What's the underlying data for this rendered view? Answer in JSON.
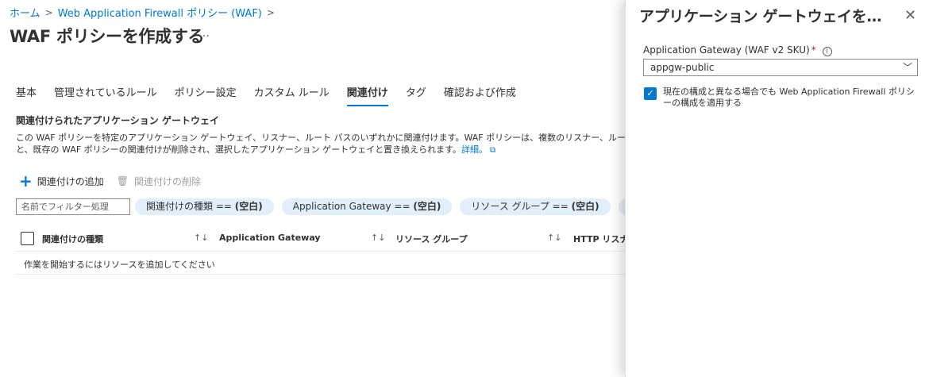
{
  "breadcrumb": {
    "items": [
      "ホーム",
      "Web Application Firewall ポリシー (WAF)"
    ],
    "separator": ">"
  },
  "page": {
    "title": "WAF ポリシーを作成する",
    "more": "…"
  },
  "tabs": [
    {
      "label": "基本",
      "active": false
    },
    {
      "label": "管理されているルール",
      "active": false
    },
    {
      "label": "ポリシー設定",
      "active": false
    },
    {
      "label": "カスタム ルール",
      "active": false
    },
    {
      "label": "関連付け",
      "active": true
    },
    {
      "label": "タグ",
      "active": false
    },
    {
      "label": "確認および作成",
      "active": false
    }
  ],
  "section": {
    "title": "関連付けられたアプリケーション ゲートウェイ",
    "description_line1": "この WAF ポリシーを特定のアプリケーション ゲートウェイ、リスナー、ルート パスのいずれかに関連付けます。WAF ポリシーは、複数のリスナー、ルート パス、アプリケーション",
    "description_line2": "と、既存の WAF ポリシーの関連付けが削除され、選択したアプリケーション ゲートウェイと置き換えられます。",
    "learn_more": "詳細。"
  },
  "toolbar": {
    "add_label": "関連付けの追加",
    "delete_label": "関連付けの削除"
  },
  "filter": {
    "placeholder": "名前でフィルター処理",
    "pills": [
      {
        "key": "関連付けの種類 == ",
        "value": "(空白)"
      },
      {
        "key": "Application Gateway == ",
        "value": "(空白)"
      },
      {
        "key": "リソース グループ == ",
        "value": "(空白)"
      },
      {
        "key": "HTTP",
        "value": ""
      }
    ]
  },
  "table": {
    "columns": [
      "関連付けの種類",
      "Application Gateway",
      "リソース グループ",
      "HTTP リスナー"
    ],
    "sort_icon": "↑↓",
    "empty_message": "作業を開始するにはリソースを追加してください"
  },
  "panel": {
    "title": "アプリケーション ゲートウェイを関連付ける",
    "close": "✕",
    "field_label": "Application Gateway (WAF v2 SKU)",
    "required_mark": "*",
    "select_value": "appgw-public",
    "checkbox_checked": true,
    "checkbox_label": "現在の構成と異なる場合でも Web Application Firewall ポリシーの構成を適用する"
  },
  "colors": {
    "accent": "#0078d4",
    "pill_bg": "#e1effa",
    "required": "#a4262c"
  }
}
